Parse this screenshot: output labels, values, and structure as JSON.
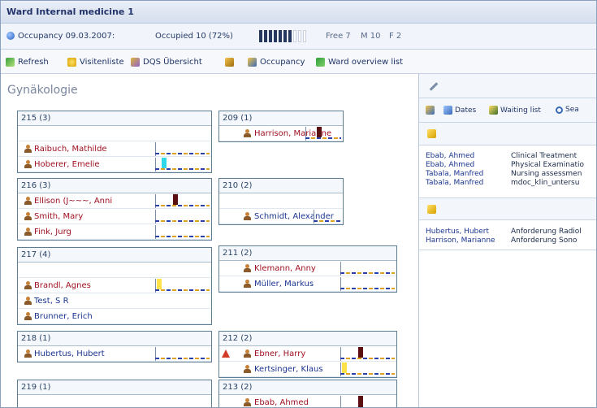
{
  "window": {
    "title": "Ward Internal medicine 1"
  },
  "occupancy": {
    "label": "Occupancy 09.03.2007:",
    "occupied": "Occupied 10 (72%)",
    "free": "Free 7",
    "m": "M 10",
    "f": "F 2"
  },
  "toolbar": {
    "refresh": "Refresh",
    "visitor_list": "Visitenliste",
    "dqs_overview": "DQS Übersicht",
    "occupancy": "Occupancy",
    "ward_overview_list": "Ward overview list"
  },
  "left": {
    "department": "Gynäkologie",
    "rooms": [
      {
        "id": "215 (3)",
        "patients": [
          "Raibuch, Mathilde",
          "Hoberer, Emelie"
        ]
      },
      {
        "id": "216 (3)",
        "patients": [
          "Ellison (J~~~, Anni",
          "Smith, Mary",
          "Fink, Jurg"
        ]
      },
      {
        "id": "217 (4)",
        "patients": [
          "Brandl, Agnes",
          "Test, S R",
          "Brunner, Erich"
        ]
      },
      {
        "id": "218 (1)",
        "patients": [
          "Hubertus, Hubert"
        ]
      },
      {
        "id": "219 (1)",
        "patients": []
      },
      {
        "id": "209 (1)",
        "patients": [
          "Harrison, Marianne"
        ]
      },
      {
        "id": "210 (2)",
        "patients": [
          "Schmidt, Alexander"
        ]
      },
      {
        "id": "211 (2)",
        "patients": [
          "Klemann, Anny",
          "Müller, Markus"
        ]
      },
      {
        "id": "212 (2)",
        "patients": [
          "Ebner, Harry",
          "Kertsinger, Klaus"
        ]
      },
      {
        "id": "213 (2)",
        "patients": [
          "Ebab, Ahmed"
        ]
      }
    ]
  },
  "right": {
    "toolbar": {
      "dates": "Dates",
      "waiting_list": "Waiting list",
      "search": "Sea"
    },
    "orders": [
      {
        "who": "Ebab, Ahmed",
        "what": "Clinical Treatment"
      },
      {
        "who": "Ebab, Ahmed",
        "what": "Physical Examinatio"
      },
      {
        "who": "Tabala, Manfred",
        "what": "Nursing assessmen"
      },
      {
        "who": "Tabala, Manfred",
        "what": "mdoc_klin_untersu"
      }
    ],
    "requests": [
      {
        "who": "Hubertus, Hubert",
        "what": "Anforderung Radiol"
      },
      {
        "who": "Harrison, Marianne",
        "what": "Anforderung Sono"
      }
    ]
  },
  "colors": {
    "accent": "#24346a",
    "patient_red": "#a01020",
    "patient_blue": "#1b3590",
    "bar_dark": "#5a1010",
    "bar_cyan": "#2fd7ea",
    "bar_yellow": "#ffe24a"
  }
}
